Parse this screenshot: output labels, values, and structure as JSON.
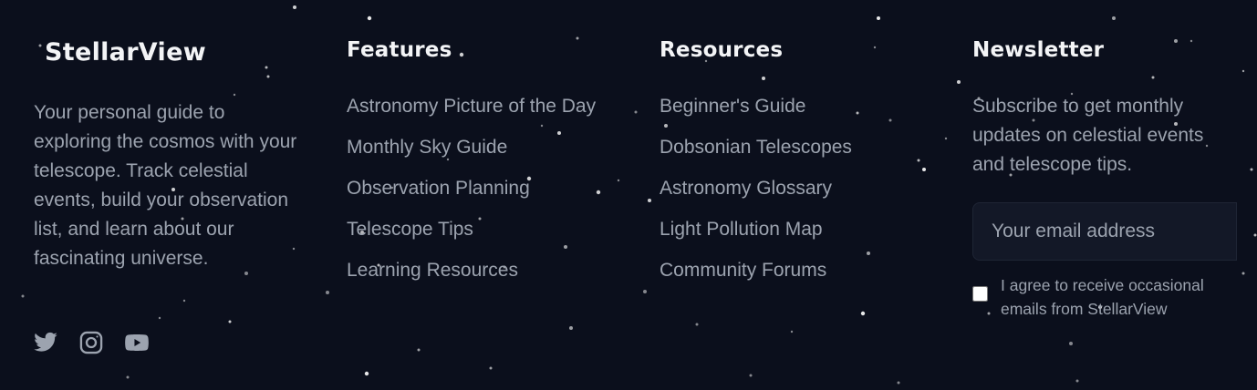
{
  "brand": {
    "name": "StellarView",
    "description": "Your personal guide to exploring the cosmos with your telescope. Track celestial events, build your observation list, and learn about our fascinating universe."
  },
  "social": [
    {
      "name": "twitter-icon"
    },
    {
      "name": "instagram-icon"
    },
    {
      "name": "youtube-icon"
    }
  ],
  "features": {
    "heading": "Features",
    "items": [
      "Astronomy Picture of the Day",
      "Monthly Sky Guide",
      "Observation Planning",
      "Telescope Tips",
      "Learning Resources"
    ]
  },
  "resources": {
    "heading": "Resources",
    "items": [
      "Beginner's Guide",
      "Dobsonian Telescopes",
      "Astronomy Glossary",
      "Light Pollution Map",
      "Community Forums"
    ]
  },
  "newsletter": {
    "heading": "Newsletter",
    "description": "Subscribe to get monthly updates on celestial events and telescope tips.",
    "email_placeholder": "Your email address",
    "email_value": "",
    "consent_label": "I agree to receive occasional emails from StellarView",
    "consent_checked": false
  },
  "colors": {
    "background": "#0b0f1c",
    "heading": "#f3f4f6",
    "text": "#9ca3af",
    "input_bg": "#131827"
  }
}
